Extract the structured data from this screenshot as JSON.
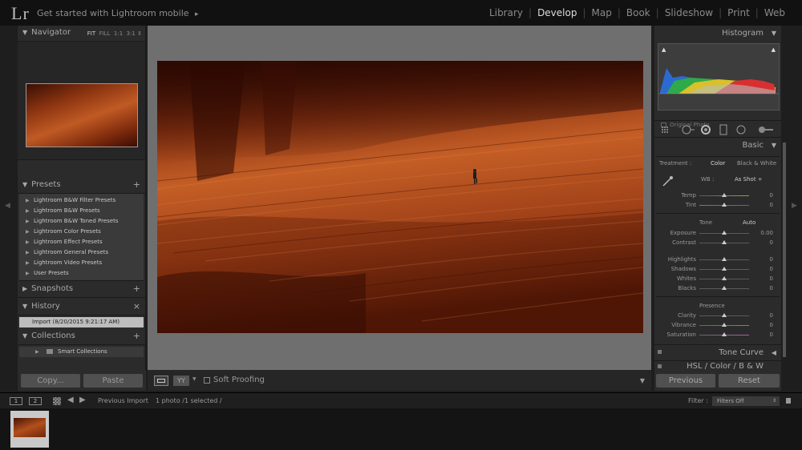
{
  "app": {
    "logo": "Lr",
    "identity_plate": "Get started with Lightroom mobile",
    "identity_arrow": "▸"
  },
  "modules": [
    "Library",
    "Develop",
    "Map",
    "Book",
    "Slideshow",
    "Print",
    "Web"
  ],
  "active_module": "Develop",
  "left_panel": {
    "navigator": {
      "title": "Navigator",
      "zoom_fit": "FIT",
      "zoom_fill": "FILL",
      "zoom_1_1": "1:1",
      "zoom_3_1": "3:1",
      "zoom_arrows": "⇕"
    },
    "presets": {
      "title": "Presets",
      "items": [
        "Lightroom B&W Filter Presets",
        "Lightroom B&W Presets",
        "Lightroom B&W Toned Presets",
        "Lightroom Color Presets",
        "Lightroom Effect Presets",
        "Lightroom General Presets",
        "Lightroom Video Presets",
        "User Presets"
      ]
    },
    "snapshots": {
      "title": "Snapshots"
    },
    "history": {
      "title": "History",
      "items": [
        "Import (8/20/2015 9:21:17 AM)"
      ]
    },
    "collections": {
      "title": "Collections",
      "items": [
        "Smart Collections"
      ]
    },
    "copy_label": "Copy...",
    "paste_label": "Paste"
  },
  "toolbar": {
    "soft_proofing": "Soft Proofing",
    "view_icon": "YY"
  },
  "right_panel": {
    "histogram_title": "Histogram",
    "original_photo": "Original Photo",
    "basic_title": "Basic",
    "treatment_label": "Treatment :",
    "treatment_color": "Color",
    "treatment_bw": "Black & White",
    "wb_label": "WB :",
    "wb_value": "As Shot ÷",
    "wb_sliders": [
      {
        "label": "Temp",
        "value": "0"
      },
      {
        "label": "Tint",
        "value": "0"
      }
    ],
    "tone_label": "Tone",
    "auto_label": "Auto",
    "tone_sliders": [
      {
        "label": "Exposure",
        "value": "0.00"
      },
      {
        "label": "Contrast",
        "value": "0"
      }
    ],
    "tone_sliders2": [
      {
        "label": "Highlights",
        "value": "0"
      },
      {
        "label": "Shadows",
        "value": "0"
      },
      {
        "label": "Whites",
        "value": "0"
      },
      {
        "label": "Blacks",
        "value": "0"
      }
    ],
    "presence_label": "Presence",
    "presence_sliders": [
      {
        "label": "Clarity",
        "value": "0"
      },
      {
        "label": "Vibrance",
        "value": "0"
      },
      {
        "label": "Saturation",
        "value": "0"
      }
    ],
    "tone_curve_title": "Tone Curve",
    "hsl_title": "HSL  /  Color  /  B & W",
    "previous_label": "Previous",
    "reset_label": "Reset"
  },
  "filmstrip": {
    "screen1": "1",
    "screen2": "2",
    "source": "Previous Import",
    "count": "1 photo /1 selected /",
    "filter_label": "Filter :",
    "filter_value": "Filters Off"
  },
  "colors": {
    "accent": "#dddddd",
    "panel": "#2b2b2b",
    "background": "#6f6f6f"
  }
}
